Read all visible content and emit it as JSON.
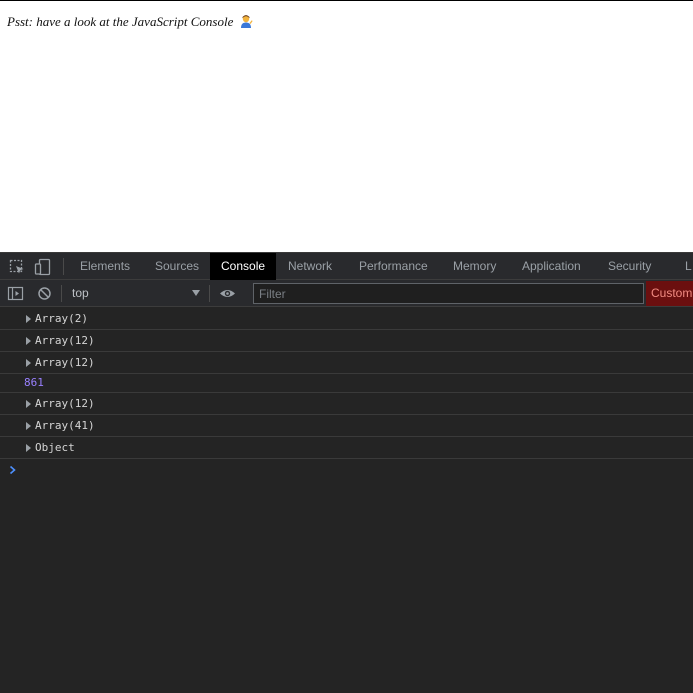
{
  "page": {
    "message": "Psst: have a look at the JavaScript Console",
    "emoji_icon": "person-tipping-hand-icon"
  },
  "devtools": {
    "tabs": [
      {
        "label": "Elements"
      },
      {
        "label": "Sources"
      },
      {
        "label": "Console",
        "active": true
      },
      {
        "label": "Network"
      },
      {
        "label": "Performance"
      },
      {
        "label": "Memory"
      },
      {
        "label": "Application"
      },
      {
        "label": "Security"
      },
      {
        "label": "L"
      }
    ],
    "toolbar": {
      "context": "top",
      "filter_placeholder": "Filter",
      "levels_label": "Custom"
    },
    "console_rows": [
      {
        "type": "object",
        "text": "Array(2)"
      },
      {
        "type": "object",
        "text": "Array(12)"
      },
      {
        "type": "object",
        "text": "Array(12)"
      },
      {
        "type": "number",
        "text": "861"
      },
      {
        "type": "object",
        "text": "Array(12)"
      },
      {
        "type": "object",
        "text": "Array(41)"
      },
      {
        "type": "object",
        "text": "Object"
      }
    ]
  },
  "colors": {
    "active_tab_bg": "#000000",
    "number_value": "#9980ff",
    "levels_bg": "#6b0f0f",
    "prompt": "#4d90fe"
  }
}
